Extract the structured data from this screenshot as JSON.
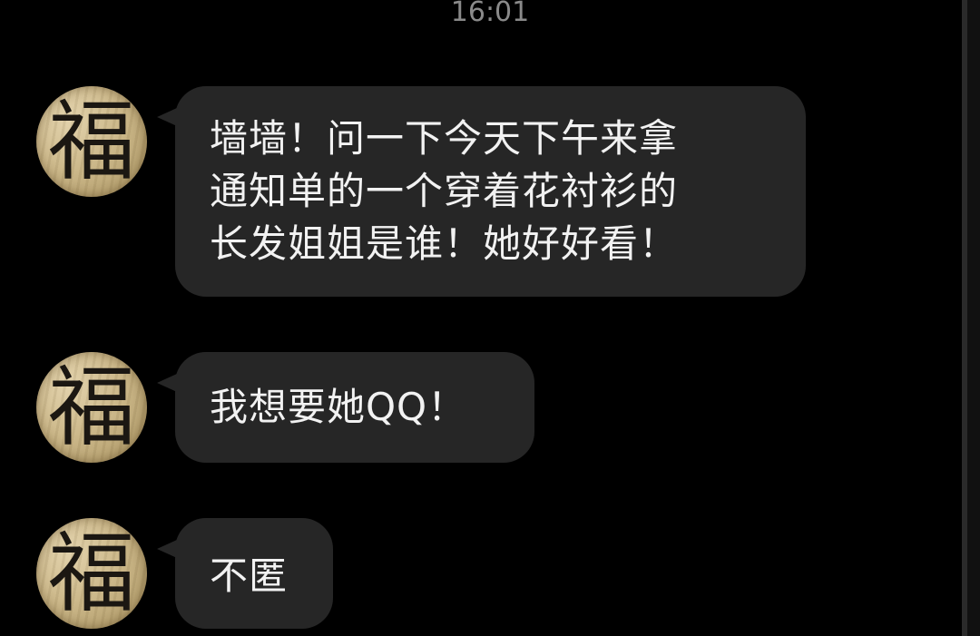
{
  "status_bar": {
    "time": "16:01"
  },
  "colors": {
    "background": "#000000",
    "bubble": "#262626",
    "bubble_text": "#f2f2f2",
    "timestamp_text": "#8a8a8a",
    "avatar_bg": "#cdb98b"
  },
  "messages": [
    {
      "avatar_glyph": "福",
      "lines": [
        "墙墙！问一下今天下午来拿",
        "通知单的一个穿着花衬衫的",
        "长发姐姐是谁！她好好看！"
      ]
    },
    {
      "avatar_glyph": "福",
      "lines": [
        "我想要她QQ！"
      ]
    },
    {
      "avatar_glyph": "福",
      "lines": [
        "不匿"
      ]
    }
  ]
}
